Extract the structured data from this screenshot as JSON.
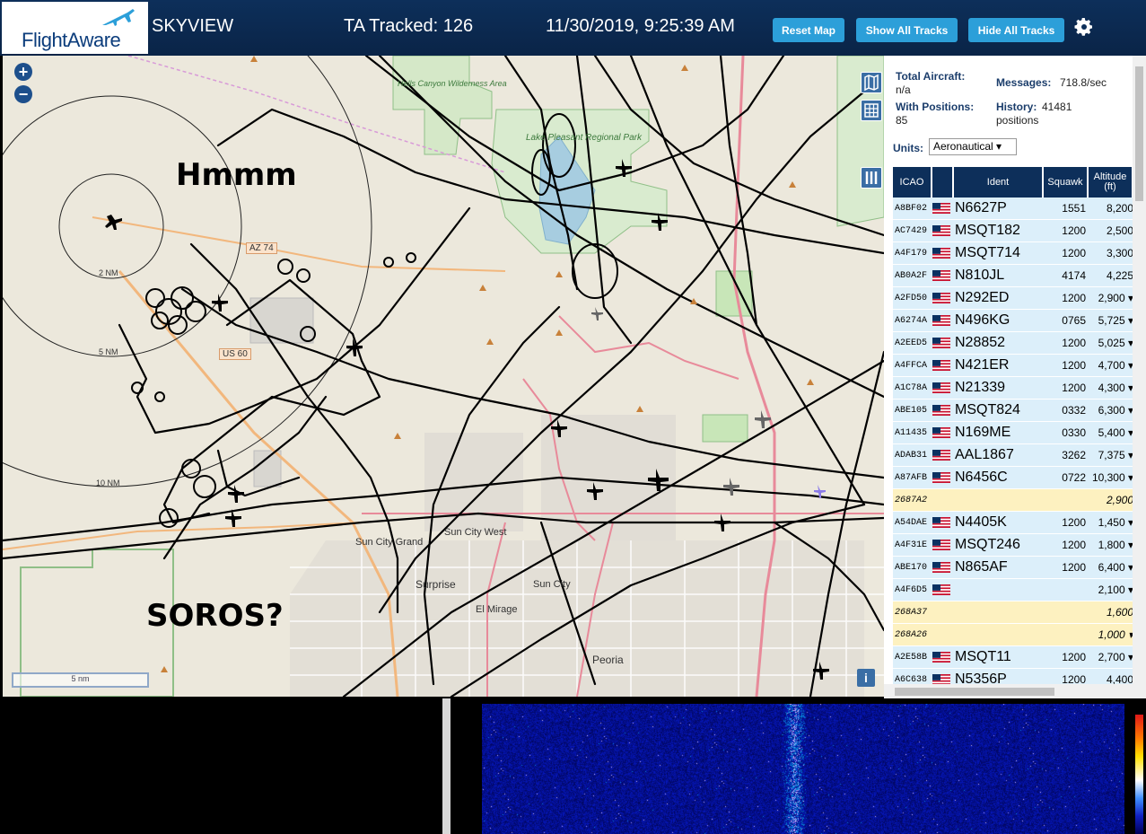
{
  "header": {
    "logo_text": "FlightAware",
    "app_name": "SKYVIEW",
    "tracked": "TA Tracked: 126",
    "datetime": "11/30/2019, 9:25:39 AM",
    "reset_map": "Reset Map",
    "show_all_tracks": "Show All Tracks",
    "hide_all_tracks": "Hide All Tracks",
    "settings_icon": "gear-icon"
  },
  "map": {
    "annotation_top": "Hmmm",
    "annotation_bottom": "SOROS?",
    "zoom_in": "+",
    "zoom_out": "−",
    "range_labels": [
      "2 NM",
      "5 NM",
      "10 NM"
    ],
    "place_labels": [
      "Hells Canyon Wilderness Area",
      "Lake Pleasant Regional Park",
      "Sun City Grand",
      "Sun City West",
      "Surprise",
      "Sun City",
      "El Mirage",
      "Peoria"
    ],
    "road_labels": [
      "AZ 74",
      "US 60"
    ],
    "scale_text": "5 nm",
    "info": "i"
  },
  "sidebar": {
    "total_aircraft_label": "Total Aircraft:",
    "total_aircraft_value": "n/a",
    "with_positions_label": "With Positions:",
    "with_positions_value": "85",
    "messages_label": "Messages:",
    "messages_value": "718.8/sec",
    "history_label": "History:",
    "history_value": "41481",
    "history_unit": "positions",
    "units_label": "Units:",
    "units_selected": "Aeronautical ▾",
    "columns": [
      "ICAO",
      "",
      "Ident",
      "Squawk",
      "Altitude (ft)"
    ],
    "rows": [
      {
        "icao": "A8BF02",
        "flag": true,
        "ident": "N6627P",
        "squawk": "1551",
        "alt": "8,200",
        "type": "blue"
      },
      {
        "icao": "AC7429",
        "flag": true,
        "ident": "MSQT182",
        "squawk": "1200",
        "alt": "2,500",
        "type": "blue"
      },
      {
        "icao": "A4F179",
        "flag": true,
        "ident": "MSQT714",
        "squawk": "1200",
        "alt": "3,300",
        "type": "blue"
      },
      {
        "icao": "AB0A2F",
        "flag": true,
        "ident": "N810JL",
        "squawk": "4174",
        "alt": "4,225",
        "type": "blue"
      },
      {
        "icao": "A2FD50",
        "flag": true,
        "ident": "N292ED",
        "squawk": "1200",
        "alt": "2,900 ▾",
        "type": "blue"
      },
      {
        "icao": "A6274A",
        "flag": true,
        "ident": "N496KG",
        "squawk": "0765",
        "alt": "5,725 ▾",
        "type": "blue"
      },
      {
        "icao": "A2EED5",
        "flag": true,
        "ident": "N28852",
        "squawk": "1200",
        "alt": "5,025 ▾",
        "type": "blue"
      },
      {
        "icao": "A4FFCA",
        "flag": true,
        "ident": "N421ER",
        "squawk": "1200",
        "alt": "4,700 ▾",
        "type": "blue"
      },
      {
        "icao": "A1C78A",
        "flag": true,
        "ident": "N21339",
        "squawk": "1200",
        "alt": "4,300 ▾",
        "type": "blue"
      },
      {
        "icao": "ABE105",
        "flag": true,
        "ident": "MSQT824",
        "squawk": "0332",
        "alt": "6,300 ▾",
        "type": "blue"
      },
      {
        "icao": "A11435",
        "flag": true,
        "ident": "N169ME",
        "squawk": "0330",
        "alt": "5,400 ▾",
        "type": "blue"
      },
      {
        "icao": "ADAB31",
        "flag": true,
        "ident": "AAL1867",
        "squawk": "3262",
        "alt": "7,375 ▾",
        "type": "blue"
      },
      {
        "icao": "A87AFB",
        "flag": true,
        "ident": "N6456C",
        "squawk": "0722",
        "alt": "10,300 ▾",
        "type": "blue"
      },
      {
        "icao": "2687A2",
        "flag": false,
        "ident": "",
        "squawk": "",
        "alt": "2,900",
        "type": "yellow"
      },
      {
        "icao": "A54DAE",
        "flag": true,
        "ident": "N4405K",
        "squawk": "1200",
        "alt": "1,450 ▾",
        "type": "blue"
      },
      {
        "icao": "A4F31E",
        "flag": true,
        "ident": "MSQT246",
        "squawk": "1200",
        "alt": "1,800 ▾",
        "type": "blue"
      },
      {
        "icao": "ABE170",
        "flag": true,
        "ident": "N865AF",
        "squawk": "1200",
        "alt": "6,400 ▾",
        "type": "blue"
      },
      {
        "icao": "A4F6D5",
        "flag": true,
        "ident": "",
        "squawk": "",
        "alt": "2,100 ▾",
        "type": "blue"
      },
      {
        "icao": "268A37",
        "flag": false,
        "ident": "",
        "squawk": "",
        "alt": "1,600",
        "type": "yellow"
      },
      {
        "icao": "268A26",
        "flag": false,
        "ident": "",
        "squawk": "",
        "alt": "1,000 ▾",
        "type": "yellow"
      },
      {
        "icao": "A2E58B",
        "flag": true,
        "ident": "MSQT11",
        "squawk": "1200",
        "alt": "2,700 ▾",
        "type": "blue"
      },
      {
        "icao": "A6C638",
        "flag": true,
        "ident": "N5356P",
        "squawk": "1200",
        "alt": "4,400",
        "type": "blue"
      }
    ]
  },
  "bottom": {
    "waterfall": "spectrum-waterfall"
  },
  "colors": {
    "header_bg": "#0d2f5a",
    "button_bg": "#2c9fd9",
    "row_blue": "#dceffa",
    "row_yellow": "#fdf1c0"
  }
}
